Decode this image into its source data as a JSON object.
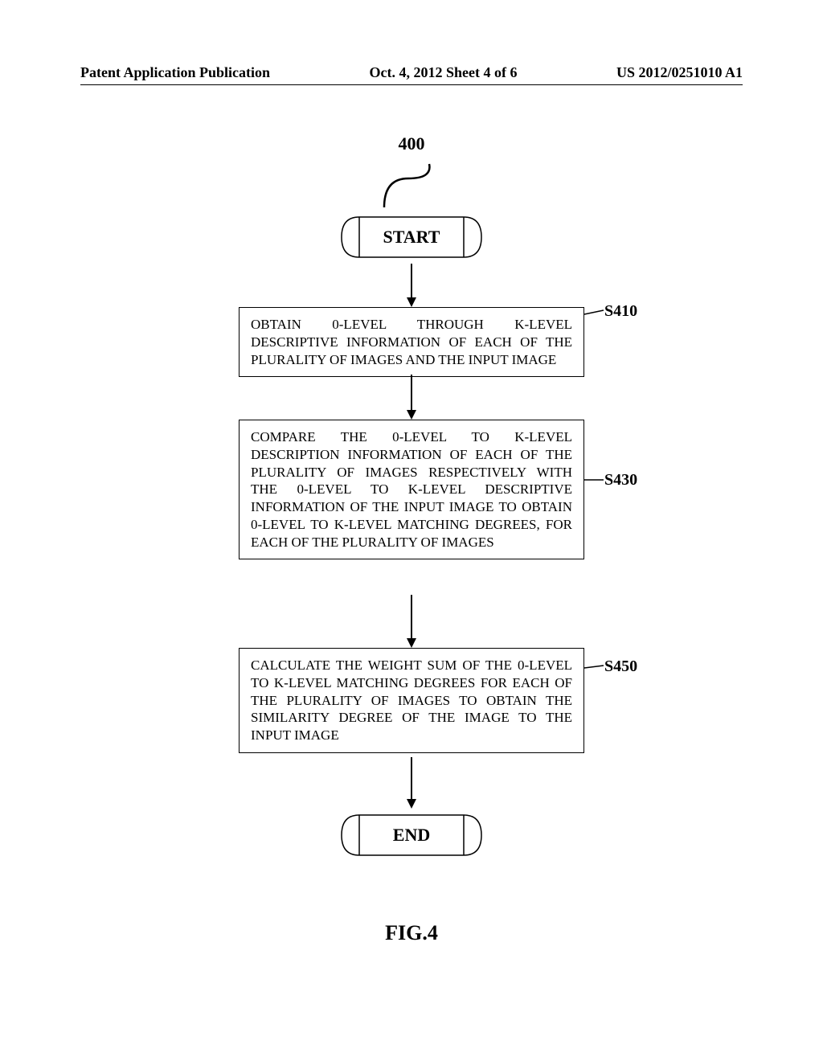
{
  "header": {
    "left": "Patent Application Publication",
    "center": "Oct. 4, 2012   Sheet 4 of 6",
    "right": "US 2012/0251010 A1"
  },
  "flow": {
    "ref_number": "400",
    "start": "START",
    "steps": {
      "s410": {
        "label": "S410",
        "text": "OBTAIN 0-LEVEL THROUGH K-LEVEL DESCRIPTIVE INFORMATION OF EACH OF THE PLURALITY OF IMAGES AND THE INPUT IMAGE"
      },
      "s430": {
        "label": "S430",
        "text": "COMPARE THE 0-LEVEL TO K-LEVEL DESCRIPTION INFORMATION OF EACH OF THE PLURALITY OF IMAGES RESPECTIVELY WITH THE 0-LEVEL TO K-LEVEL DESCRIPTIVE INFORMATION OF THE INPUT IMAGE TO OBTAIN 0-LEVEL TO K-LEVEL MATCHING DEGREES, FOR EACH OF THE PLURALITY OF IMAGES"
      },
      "s450": {
        "label": "S450",
        "text": "CALCULATE THE WEIGHT SUM OF THE 0-LEVEL TO K-LEVEL MATCHING DEGREES FOR EACH OF THE PLURALITY OF IMAGES TO OBTAIN THE SIMILARITY DEGREE OF THE IMAGE TO THE INPUT IMAGE"
      }
    },
    "end": "END"
  },
  "figure_caption": "FIG.4"
}
